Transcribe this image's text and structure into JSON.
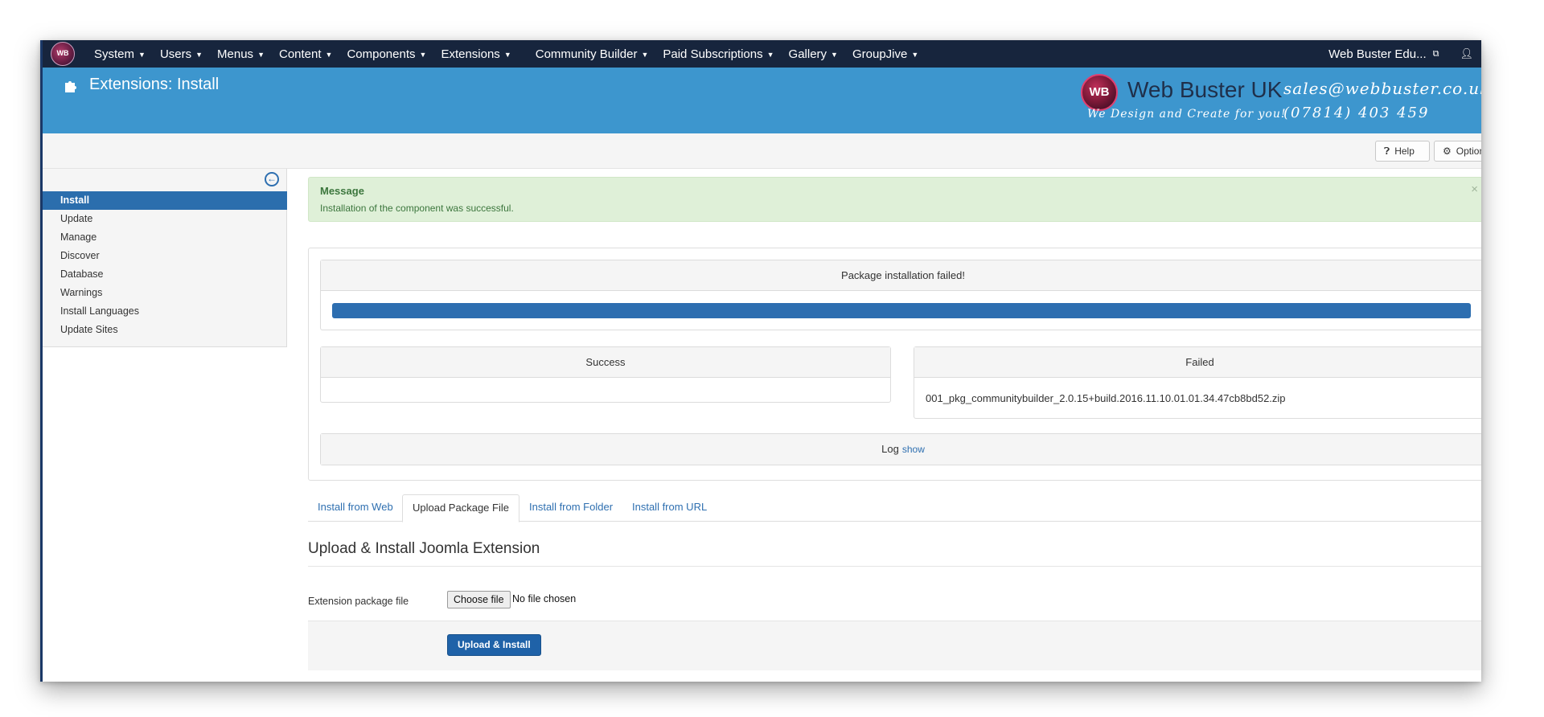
{
  "navbar": {
    "logo_text": "WB",
    "menu": [
      {
        "label": "System"
      },
      {
        "label": "Users"
      },
      {
        "label": "Menus"
      },
      {
        "label": "Content"
      },
      {
        "label": "Components"
      },
      {
        "label": "Extensions"
      },
      {
        "label": "Community Builder"
      },
      {
        "label": "Paid Subscriptions"
      },
      {
        "label": "Gallery"
      },
      {
        "label": "GroupJive"
      }
    ],
    "site_name": "Web Buster Edu..."
  },
  "header": {
    "title": "Extensions: Install",
    "brand": {
      "logo_text": "WB",
      "name": "Web Buster UK",
      "email": "sales@webbuster.co.uk",
      "tagline": "We Design and Create for you!",
      "phone": "(07814) 403 459"
    }
  },
  "toolbar": {
    "help_label": "Help",
    "options_label": "Options"
  },
  "sidebar": {
    "items": [
      {
        "label": "Install",
        "active": true
      },
      {
        "label": "Update"
      },
      {
        "label": "Manage"
      },
      {
        "label": "Discover"
      },
      {
        "label": "Database"
      },
      {
        "label": "Warnings"
      },
      {
        "label": "Install Languages"
      },
      {
        "label": "Update Sites"
      }
    ]
  },
  "message": {
    "heading": "Message",
    "text": "Installation of the component was successful."
  },
  "install_result": {
    "status": "Package installation failed!",
    "progress_percent": 100,
    "success_label": "Success",
    "failed_label": "Failed",
    "failed_file": "001_pkg_communitybuilder_2.0.15+build.2016.11.10.01.01.34.47cb8bd52.zip",
    "log_label": "Log",
    "log_link": "show"
  },
  "tabs": [
    {
      "label": "Install from Web"
    },
    {
      "label": "Upload Package File",
      "active": true
    },
    {
      "label": "Install from Folder"
    },
    {
      "label": "Install from URL"
    }
  ],
  "upload_form": {
    "title": "Upload & Install Joomla Extension",
    "field_label": "Extension package file",
    "choose_button": "Choose file",
    "file_status": "No file chosen",
    "submit_label": "Upload & Install"
  },
  "colors": {
    "navbar": "#17253d",
    "header": "#3d96ce",
    "accent": "#2b6ead",
    "success_bg": "#dff0d8"
  }
}
